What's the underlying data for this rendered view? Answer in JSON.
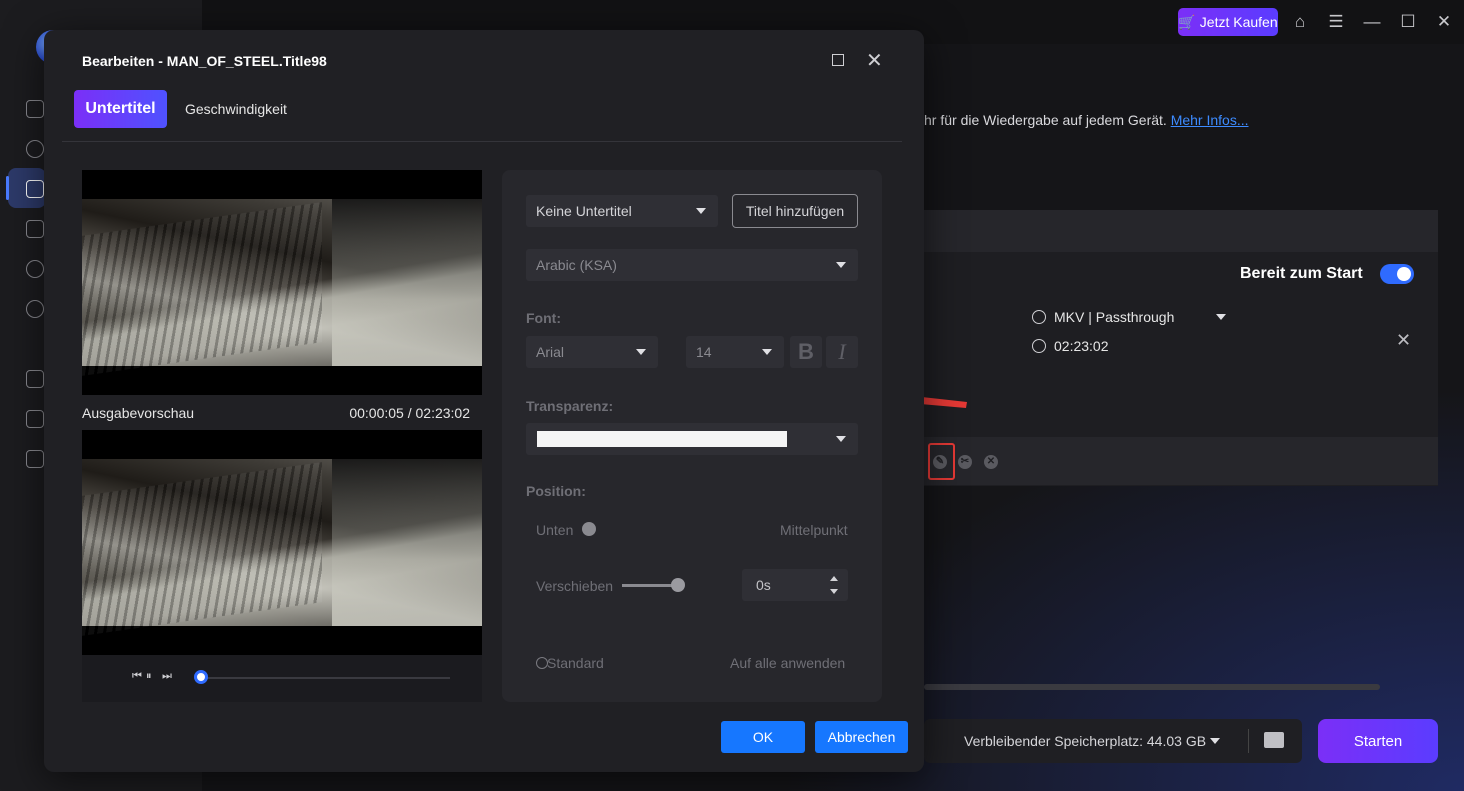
{
  "app": {
    "buy_label": "Jetzt Kaufen",
    "info_text": "hr für die Wiedergabe auf jedem Gerät.",
    "info_link": "Mehr Infos...",
    "ready_label": "Bereit zum Start",
    "format_label": "MKV | Passthrough",
    "duration_label": "02:23:02",
    "storage_label": "Verbleibender Speicherplatz: 44.03 GB",
    "start_label": "Starten",
    "accent": "#7b2ff7",
    "highlight_color": "#e53935"
  },
  "dialog": {
    "title": "Bearbeiten - MAN_OF_STEEL.Title98",
    "tabs": [
      {
        "label": "Untertitel",
        "active": true
      },
      {
        "label": "Geschwindigkeit",
        "active": false
      }
    ],
    "preview": {
      "label": "Ausgabevorschau",
      "time": "00:00:05 / 02:23:02",
      "progress": 0
    },
    "subtitle": {
      "select_value": "Keine Untertitel",
      "add_label": "Titel hinzufügen",
      "language_value": "Arabic (KSA)",
      "font_label": "Font:",
      "font_value": "Arial",
      "size_value": "14",
      "bold_glyph": "B",
      "italic_glyph": "I",
      "transparency_label": "Transparenz:",
      "position_label": "Position:",
      "position_bottom": "Unten",
      "position_center": "Mittelpunkt",
      "shift_label": "Verschieben",
      "shift_value": "0s",
      "default_label": "Standard",
      "apply_all_label": "Auf alle anwenden"
    },
    "ok_label": "OK",
    "cancel_label": "Abbrechen"
  }
}
